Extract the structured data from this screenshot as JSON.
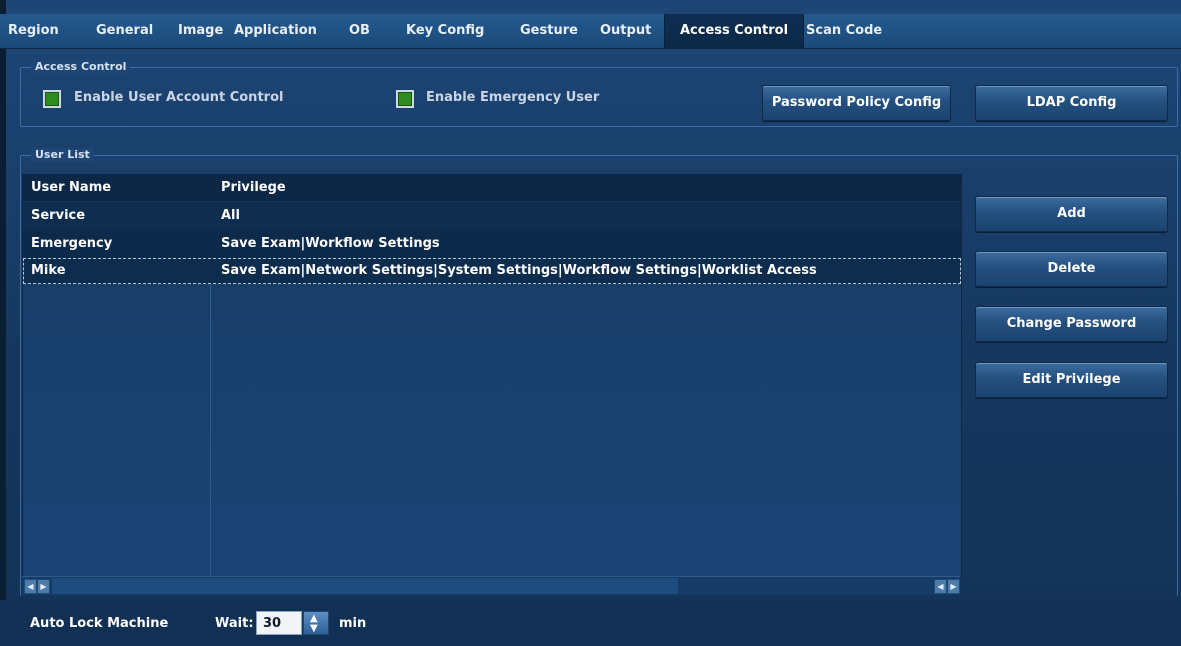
{
  "tabs": [
    {
      "label": "Region"
    },
    {
      "label": "General"
    },
    {
      "label": "Image"
    },
    {
      "label": "Application"
    },
    {
      "label": "OB"
    },
    {
      "label": "Key Config"
    },
    {
      "label": "Gesture"
    },
    {
      "label": "Output"
    },
    {
      "label": "Access Control",
      "active": true
    },
    {
      "label": "Scan Code"
    }
  ],
  "access_control": {
    "legend": "Access Control",
    "enable_user_account_control": {
      "label": "Enable User Account Control",
      "checked": true
    },
    "enable_emergency_user": {
      "label": "Enable Emergency User",
      "checked": true
    },
    "password_policy_button": "Password Policy Config",
    "ldap_button": "LDAP Config"
  },
  "user_list": {
    "legend": "User List",
    "columns": [
      "User Name",
      "Privilege"
    ],
    "rows": [
      {
        "user": "Service",
        "privilege": "All"
      },
      {
        "user": "Emergency",
        "privilege": "Save Exam|Workflow Settings"
      },
      {
        "user": "Mike",
        "privilege": "Save Exam|Network Settings|System Settings|Workflow Settings|Worklist Access",
        "selected": true
      }
    ],
    "buttons": {
      "add": "Add",
      "delete": "Delete",
      "change_password": "Change Password",
      "edit_privilege": "Edit Privilege"
    }
  },
  "auto_lock": {
    "label": "Auto Lock Machine",
    "wait_label": "Wait:",
    "wait_value": "30",
    "unit": "min"
  },
  "colors": {
    "background": "#1d4676",
    "tab_active": "#0e2e52",
    "checkbox": "#2f8a1f",
    "accent_border": "#3b6ea8"
  }
}
